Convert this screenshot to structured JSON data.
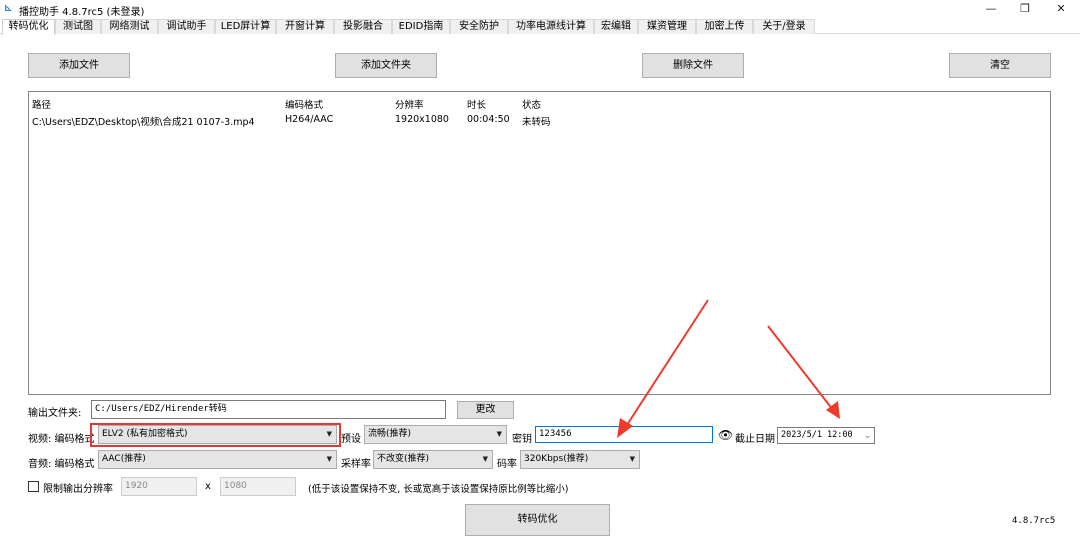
{
  "window": {
    "title": "播控助手 4.8.7rc5 (未登录)",
    "minimize": "—",
    "maximize": "❐",
    "close": "✕"
  },
  "tabs": [
    "转码优化",
    "测试图",
    "网络测试",
    "调试助手",
    "LED屏计算",
    "开窗计算",
    "投影融合",
    "EDID指南",
    "安全防护",
    "功率电源线计算",
    "宏编辑",
    "媒资管理",
    "加密上传",
    "关于/登录"
  ],
  "toolbar": {
    "add_file": "添加文件",
    "add_folder": "添加文件夹",
    "delete_file": "删除文件",
    "clear": "清空"
  },
  "file_list": {
    "headers": [
      "路径",
      "编码格式",
      "分辨率",
      "时长",
      "状态"
    ],
    "rows": [
      [
        "C:\\Users\\EDZ\\Desktop\\视频\\合成21 0107-3.mp4",
        "H264/AAC",
        "1920x1080",
        "00:04:50",
        "未转码"
      ]
    ]
  },
  "output": {
    "label": "输出文件夹:",
    "path": "C:/Users/EDZ/Hirender转码",
    "change_button": "更改"
  },
  "video": {
    "label": "视频: 编码格式",
    "format": "ELV2 (私有加密格式)",
    "preset_label": "预设",
    "preset": "流畅(推荐)",
    "key_label": "密钥",
    "key_value": "123456",
    "expiry_label": "截止日期",
    "expiry_value": "2023/5/1  12:00"
  },
  "audio": {
    "label": "音频: 编码格式",
    "format": "AAC(推荐)",
    "samplerate_label": "采样率",
    "samplerate": "不改变(推荐)",
    "bitrate_label": "码率",
    "bitrate": "320Kbps(推荐)"
  },
  "resolution": {
    "checkbox_label": "限制输出分辨率",
    "checked": false,
    "width": "1920",
    "x_label": "x",
    "height": "1080",
    "hint": "(低于该设置保持不变, 长或宽高于该设置保持原比例等比缩小)"
  },
  "transcode_button": "转码优化",
  "version": "4.8.7rc5",
  "colors": {
    "highlight": "#e53935",
    "arrow": "#ef3b2c",
    "focus": "#0078d7"
  }
}
